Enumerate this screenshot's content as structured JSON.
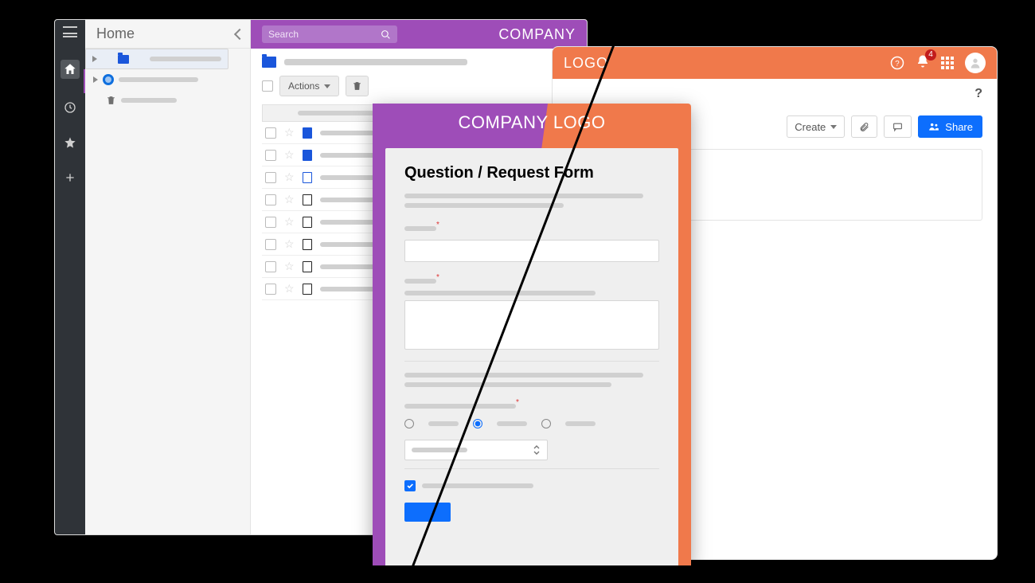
{
  "leftApp": {
    "nav_title": "Home",
    "search_placeholder": "Search",
    "brand": "COMPANY",
    "actions_label": "Actions",
    "rail_icons": [
      "menu",
      "home",
      "clock",
      "star",
      "plus"
    ],
    "tree": [
      {
        "icon": "folder",
        "selected": true
      },
      {
        "icon": "people",
        "selected": false
      },
      {
        "icon": "trash",
        "selected": false
      }
    ],
    "rows": [
      {
        "icon": "blue"
      },
      {
        "icon": "blue"
      },
      {
        "icon": "img"
      },
      {
        "icon": "doc"
      },
      {
        "icon": "doc"
      },
      {
        "icon": "doc"
      },
      {
        "icon": "doc"
      },
      {
        "icon": "doc"
      }
    ]
  },
  "rightApp": {
    "brand": "LOGO",
    "notification_count": "4",
    "create_label": "Create",
    "share_label": "Share",
    "help": "?"
  },
  "modal": {
    "header": "COMPANY LOGO",
    "title": "Question / Request Form"
  },
  "colors": {
    "purple": "#9e4db8",
    "orange": "#f0794b",
    "blue": "#0d6efd"
  }
}
